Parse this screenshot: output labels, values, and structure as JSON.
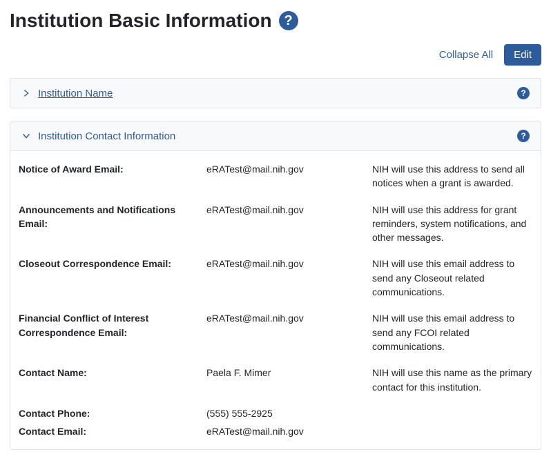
{
  "header": {
    "title": "Institution Basic Information"
  },
  "actions": {
    "collapse_all": "Collapse All",
    "edit": "Edit"
  },
  "panels": {
    "name": {
      "title": "Institution Name"
    },
    "contact": {
      "title": "Institution Contact Information",
      "fields": {
        "notice_award": {
          "label": "Notice of Award Email:",
          "value": "eRATest@mail.nih.gov",
          "desc": "NIH will use this address to send all notices when a grant is awarded."
        },
        "announcements": {
          "label": "Announcements and Notifications Email:",
          "value": "eRATest@mail.nih.gov",
          "desc": "NIH will use this address for grant reminders, system notifications, and other messages."
        },
        "closeout": {
          "label": "Closeout Correspondence Email:",
          "value": "eRATest@mail.nih.gov",
          "desc": "NIH will use this email address to send any Closeout related communications."
        },
        "fcoi": {
          "label": "Financial Conflict of Interest Correspondence Email:",
          "value": "eRATest@mail.nih.gov",
          "desc": "NIH will use this email address to send any FCOI related communications."
        },
        "contact_name": {
          "label": "Contact Name:",
          "value": "Paela F. Mimer",
          "desc": "NIH will use this name as the primary contact for this institution."
        },
        "contact_phone": {
          "label": "Contact Phone:",
          "value": "(555) 555-2925",
          "desc": ""
        },
        "contact_email": {
          "label": "Contact Email:",
          "value": "eRATest@mail.nih.gov",
          "desc": ""
        }
      }
    }
  }
}
